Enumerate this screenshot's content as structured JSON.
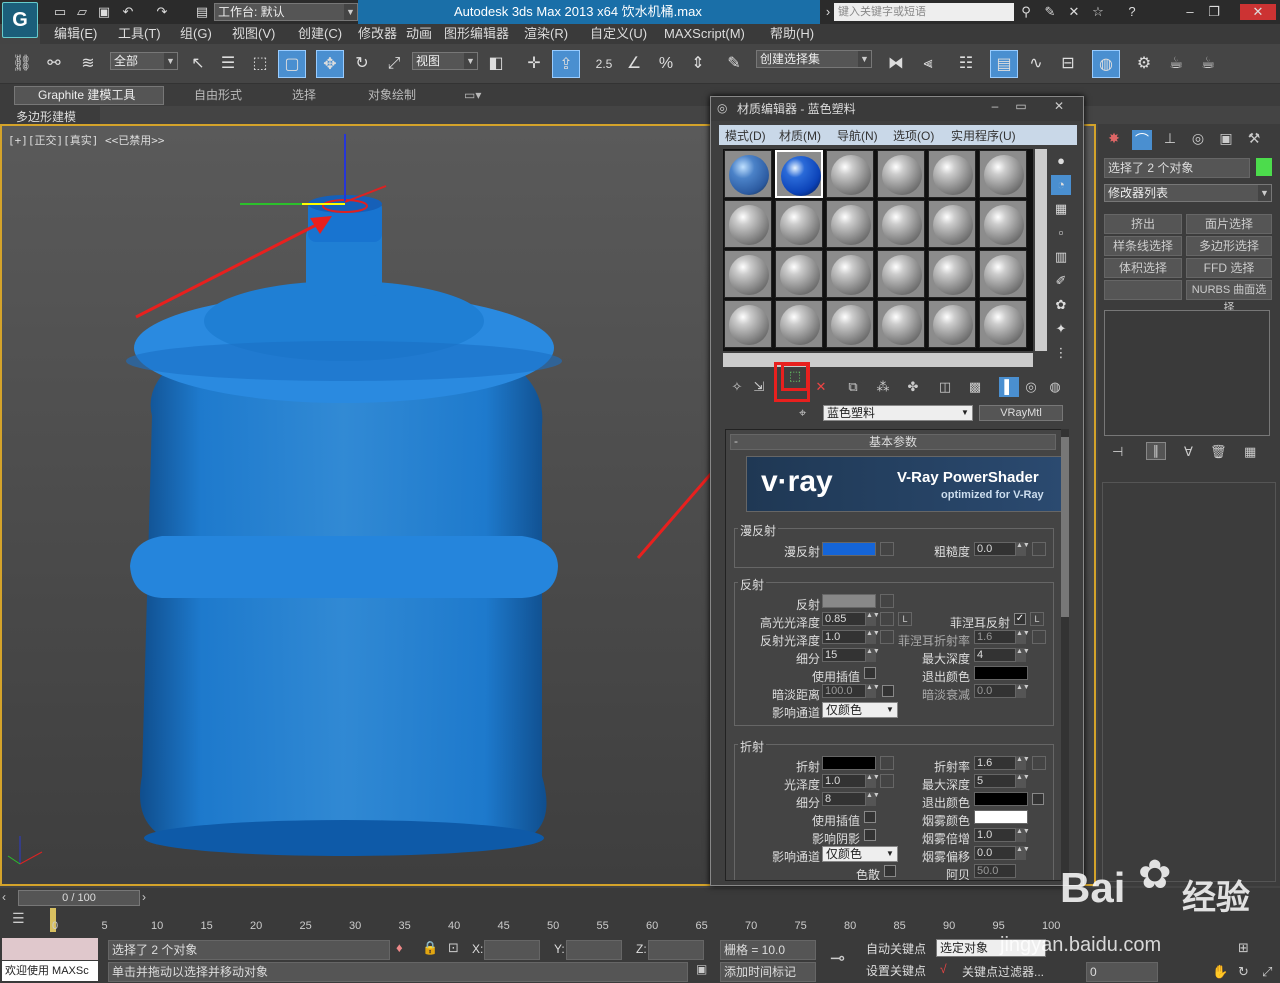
{
  "window": {
    "app_title": "Autodesk 3ds Max  2013 x64      饮水机桶.max",
    "workspace": "工作台: 默认",
    "search_placeholder": "键入关键字或短语"
  },
  "menubar": [
    "编辑(E)",
    "工具(T)",
    "组(G)",
    "视图(V)",
    "创建(C)",
    "修改器",
    "动画",
    "图形编辑器",
    "渲染(R)",
    "自定义(U)",
    "MAXScript(M)",
    "帮助(H)"
  ],
  "toolbar": {
    "selection_filter": "全部",
    "ref_coord": "视图",
    "named_selection": "创建选择集",
    "snap_value": "2.5"
  },
  "ribbon": {
    "tabs": [
      "Graphite 建模工具",
      "自由形式",
      "选择",
      "对象绘制"
    ],
    "subtab": "多边形建模"
  },
  "viewport": {
    "label": "[+][正交][真实] <<已禁用>>"
  },
  "right_panel": {
    "selection": "选择了 2 个对象",
    "modifier_list": "修改器列表",
    "buttons": [
      "挤出",
      "面片选择",
      "样条线选择",
      "多边形选择",
      "体积选择",
      "FFD 选择",
      "",
      "NURBS 曲面选择"
    ]
  },
  "material_editor": {
    "title": "材质编辑器 - 蓝色塑料",
    "menu": [
      "模式(D)",
      "材质(M)",
      "导航(N)",
      "选项(O)",
      "实用程序(U)"
    ],
    "material_name": "蓝色塑料",
    "material_type": "VRayMtl",
    "rollout": "基本参数",
    "vray_banner": {
      "logo": "v·ray",
      "title": "V-Ray PowerShader",
      "subtitle": "optimized for V-Ray"
    },
    "diffuse": {
      "group": "漫反射",
      "label": "漫反射",
      "roughness_label": "粗糙度",
      "roughness": "0.0",
      "color": "#1565d8"
    },
    "reflection": {
      "group": "反射",
      "reflect": "反射",
      "hilight_gloss_label": "高光光泽度",
      "hilight_gloss": "0.85",
      "refl_gloss_label": "反射光泽度",
      "refl_gloss": "1.0",
      "subdivs_label": "细分",
      "subdivs": "15",
      "use_interp": "使用插值",
      "dim_dist_label": "暗淡距离",
      "dim_dist": "100.0",
      "affect_ch_label": "影响通道",
      "affect_ch": "仅颜色",
      "fresnel_label": "菲涅耳反射",
      "fresnel_ior_label": "菲涅耳折射率",
      "fresnel_ior": "1.6",
      "max_depth_label": "最大深度",
      "max_depth": "4",
      "exit_color_label": "退出颜色",
      "dim_falloff_label": "暗淡衰减",
      "dim_falloff": "0.0",
      "L": "L",
      "reflect_color": "#888888"
    },
    "refraction": {
      "group": "折射",
      "refract": "折射",
      "ior_label": "折射率",
      "ior": "1.6",
      "gloss_label": "光泽度",
      "gloss": "1.0",
      "max_depth_label": "最大深度",
      "max_depth": "5",
      "subdivs_label": "细分",
      "subdivs": "8",
      "exit_color_label": "退出颜色",
      "use_interp": "使用插值",
      "fog_color_label": "烟雾颜色",
      "affect_shadows": "影响阴影",
      "fog_mult_label": "烟雾倍增",
      "fog_mult": "1.0",
      "affect_ch_label": "影响通道",
      "affect_ch": "仅颜色",
      "fog_bias_label": "烟雾偏移",
      "fog_bias": "0.0",
      "dispersion": "色散",
      "abbe_label": "阿贝",
      "abbe": "50.0"
    }
  },
  "timeline": {
    "frame": "0 / 100",
    "ticks": [
      "0",
      "5",
      "10",
      "15",
      "20",
      "25",
      "30",
      "35",
      "40",
      "45",
      "50",
      "55",
      "60",
      "65",
      "70",
      "75",
      "80",
      "85",
      "90",
      "95",
      "100"
    ]
  },
  "status": {
    "selected": "选择了 2 个对象",
    "prompt": "单击并拖动以选择并移动对象",
    "maxscript": "欢迎使用 MAXSc",
    "x_label": "X:",
    "y_label": "Y:",
    "z_label": "Z:",
    "grid": "栅格 = 10.0",
    "add_time_tag": "添加时间标记",
    "auto_key": "自动关键点",
    "set_key": "设置关键点",
    "sel_object": "选定对象",
    "key_filters": "关键点过滤器...",
    "frame": "0"
  },
  "watermark": {
    "brand": "Bai",
    "cn": "经验",
    "url": "jingyan.baidu.com"
  }
}
